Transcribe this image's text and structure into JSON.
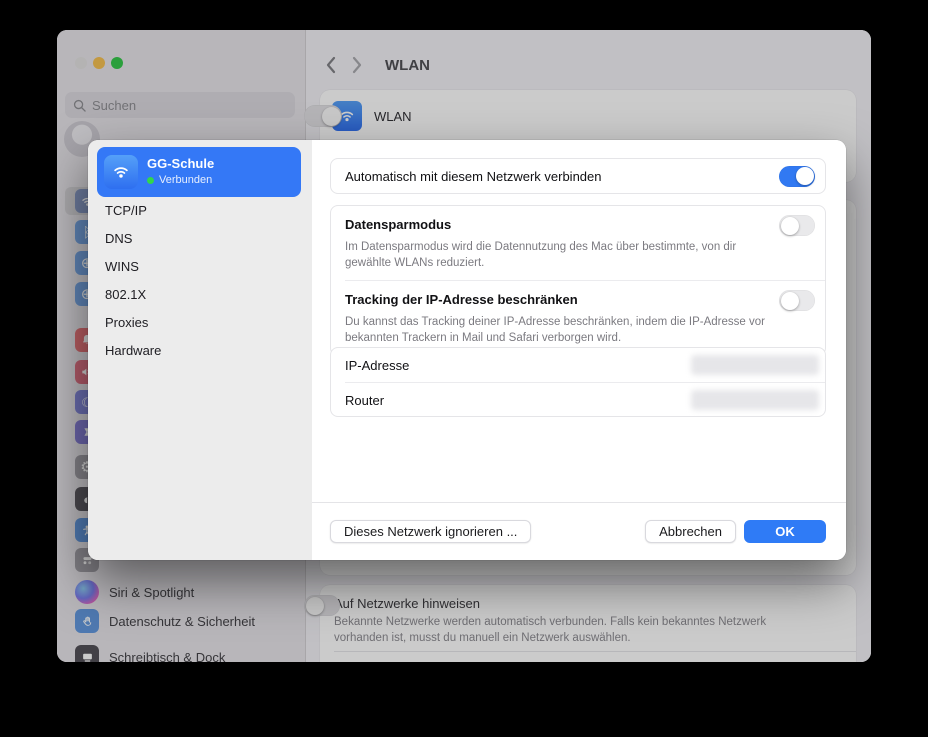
{
  "window": {
    "header": {
      "title": "WLAN"
    },
    "search": {
      "placeholder": "Suchen"
    },
    "sidebar_items": [
      {
        "icon": "wifi-icon",
        "label": ""
      },
      {
        "icon": "bluetooth-icon",
        "label": ""
      },
      {
        "icon": "globe-icon",
        "label": ""
      },
      {
        "icon": "vpn-globe-icon",
        "label": ""
      },
      {
        "icon": "bell-icon",
        "label": ""
      },
      {
        "icon": "speaker-icon",
        "label": ""
      },
      {
        "icon": "moon-icon",
        "label": ""
      },
      {
        "icon": "hourglass-icon",
        "label": ""
      },
      {
        "icon": "gear-icon",
        "label": ""
      },
      {
        "icon": "appearance-icon",
        "label": ""
      },
      {
        "icon": "accessibility-icon",
        "label": ""
      },
      {
        "icon": "control-center-icon",
        "label": ""
      },
      {
        "icon": "siri-icon",
        "label": "Siri & Spotlight"
      },
      {
        "icon": "privacy-hand-icon",
        "label": "Datenschutz & Sicherheit"
      },
      {
        "icon": "desktop-dock-icon",
        "label": "Schreibtisch & Dock"
      }
    ],
    "wlan_row": {
      "label": "WLAN",
      "enabled": true
    },
    "hint_row": {
      "title": "Auf Netzwerke hinweisen",
      "description": "Bekannte Netzwerke werden automatisch verbunden. Falls kein bekanntes Netzwerk\nvorhanden ist, musst du manuell ein Netzwerk auswählen.",
      "enabled": false
    }
  },
  "sheet": {
    "network": {
      "name": "GG-Schule",
      "status": "Verbunden"
    },
    "tabs": [
      "TCP/IP",
      "DNS",
      "WINS",
      "802.1X",
      "Proxies",
      "Hardware"
    ],
    "settings": {
      "auto_join": {
        "label": "Automatisch mit diesem Netzwerk verbinden",
        "enabled": true
      },
      "low_data": {
        "label": "Datensparmodus",
        "description": "Im Datensparmodus wird die Datennutzung des Mac über bestimmte, von dir\ngewählte WLANs reduziert.",
        "enabled": false
      },
      "limit_tracking": {
        "label": "Tracking der IP-Adresse beschränken",
        "description": "Du kannst das Tracking deiner IP-Adresse beschränken, indem die IP-Adresse vor\nbekannten Trackern in Mail und Safari verborgen wird.",
        "enabled": false
      },
      "ip_address_label": "IP-Adresse",
      "router_label": "Router"
    },
    "buttons": {
      "ignore": "Dieses Netzwerk ignorieren ...",
      "cancel": "Abbrechen",
      "ok": "OK"
    }
  },
  "colors": {
    "accent": "#3478F6",
    "ok_button": "#2F7BF6",
    "connected_green": "#32D74B",
    "selected_row": "#3478F6"
  }
}
